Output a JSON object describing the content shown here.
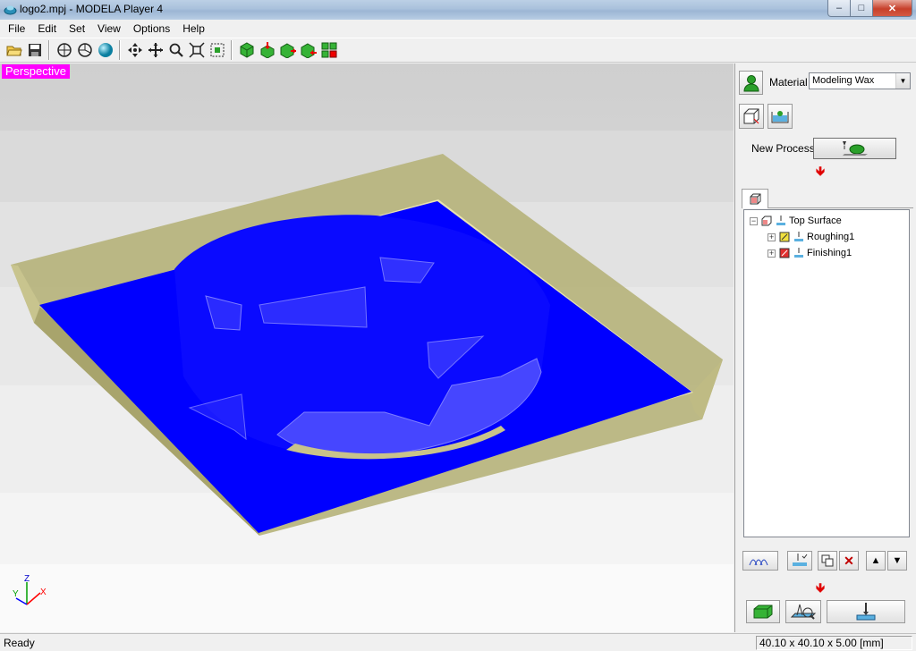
{
  "window": {
    "title": "logo2.mpj - MODELA Player 4",
    "minimize_glyph": "‒",
    "maximize_glyph": "□",
    "close_glyph": "✕"
  },
  "menu": [
    "File",
    "Edit",
    "Set",
    "View",
    "Options",
    "Help"
  ],
  "toolbar": {
    "groups": [
      [
        "open-folder-icon",
        "save-icon"
      ],
      [
        "view-rotate-icon",
        "view-tilt-icon",
        "render-sphere-icon"
      ],
      [
        "pan-icon",
        "move-icon",
        "zoom-icon",
        "fit-view-icon",
        "zoom-window-icon"
      ],
      [
        "cube-icon",
        "cube-down-icon",
        "cube-right-icon",
        "cube-left-icon",
        "cube-grid-icon"
      ]
    ]
  },
  "viewport": {
    "view_label": "Perspective",
    "axis": {
      "x": "X",
      "y": "Y",
      "z": "Z"
    },
    "colors": {
      "label_bg": "#ff00ff",
      "material": "#b6b27a",
      "toolpath": "#0000ff"
    }
  },
  "panel": {
    "material_label": "Material",
    "material_value": "Modeling Wax",
    "new_process_label": "New Process",
    "tree": {
      "root": "Top Surface",
      "children": [
        "Roughing1",
        "Finishing1"
      ]
    },
    "arrow_up": "▲",
    "arrow_down": "▼",
    "delete_glyph": "✕",
    "red_arrow": "🡻"
  },
  "status": {
    "text": "Ready",
    "dimensions": "40.10 x 40.10 x 5.00 [mm]"
  }
}
